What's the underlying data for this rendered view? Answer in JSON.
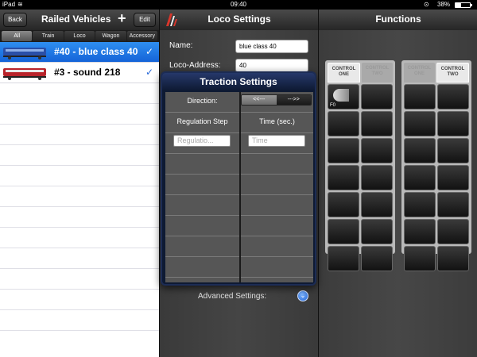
{
  "status_bar": {
    "device": "iPad",
    "time": "09:40",
    "battery": "38%",
    "battery_level": 0.38
  },
  "left_panel": {
    "back_label": "Back",
    "title": "Railed Vehicles",
    "add_label": "+",
    "edit_label": "Edit",
    "segments": [
      "All",
      "Train",
      "Loco",
      "Wagon",
      "Accessory"
    ],
    "selected_segment": "All",
    "vehicles": [
      {
        "label": "#40 - blue class 40",
        "selected": true,
        "checkmark": "✓",
        "color": "#2a4fa8"
      },
      {
        "label": "#3 - sound 218",
        "selected": false,
        "checkmark": "✓",
        "color": "#b8232a"
      }
    ]
  },
  "middle_panel": {
    "title": "Loco Settings",
    "name_label": "Name:",
    "name_value": "blue class 40",
    "address_label": "Loco-Address:",
    "address_value": "40",
    "advanced_label": "Advanced Settings:"
  },
  "traction": {
    "title": "Traction Settings",
    "direction_label": "Direction:",
    "dir_back": "<<---",
    "dir_forward": "--->>",
    "col_step": "Regulation Step",
    "col_time": "Time (sec.)",
    "step_placeholder": "Regulatio...",
    "time_placeholder": "Time"
  },
  "right_panel": {
    "title": "Functions",
    "blocks": [
      {
        "tab_one": "CONTROL ONE",
        "tab_two": "CONTROL TWO",
        "active": "one"
      },
      {
        "tab_one": "CONTROL ONE",
        "tab_two": "CONTROL TWO",
        "active": "two"
      }
    ],
    "f0_label": "F0"
  }
}
